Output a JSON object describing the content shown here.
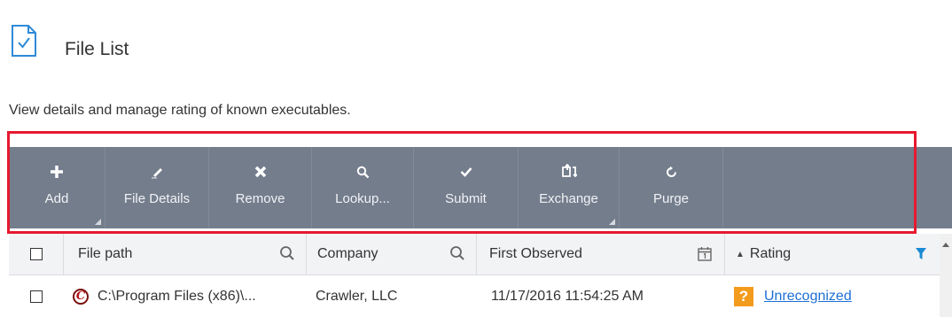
{
  "header": {
    "title": "File List",
    "description": "View details and manage rating of known executables."
  },
  "toolbar": {
    "buttons": [
      {
        "label": "Add",
        "icon": "plus-icon",
        "has_dropdown": true
      },
      {
        "label": "File Details",
        "icon": "pencil-icon",
        "has_dropdown": false
      },
      {
        "label": "Remove",
        "icon": "x-icon",
        "has_dropdown": false
      },
      {
        "label": "Lookup...",
        "icon": "search-icon",
        "has_dropdown": false
      },
      {
        "label": "Submit",
        "icon": "check-icon",
        "has_dropdown": false
      },
      {
        "label": "Exchange",
        "icon": "exchange-icon",
        "has_dropdown": true
      },
      {
        "label": "Purge",
        "icon": "refresh-icon",
        "has_dropdown": false
      }
    ]
  },
  "table": {
    "columns": [
      {
        "label": "",
        "key": "select"
      },
      {
        "label": "File path",
        "key": "file_path"
      },
      {
        "label": "Company",
        "key": "company"
      },
      {
        "label": "First Observed",
        "key": "first_observed"
      },
      {
        "label": "Rating",
        "key": "rating",
        "sort": "ascending"
      }
    ],
    "rows": [
      {
        "file_path": "C:\\Program Files (x86)\\...",
        "company": "Crawler, LLC",
        "first_observed": "11/17/2016 11:54:25 AM",
        "rating": "Unrecognized",
        "rating_badge": "?"
      }
    ]
  },
  "colors": {
    "toolbar_bg": "#747d8c",
    "highlight": "#e6192f",
    "link": "#1d6fd6",
    "filter_icon": "#1a8ad4",
    "rating_badge": "#f39b1c"
  }
}
